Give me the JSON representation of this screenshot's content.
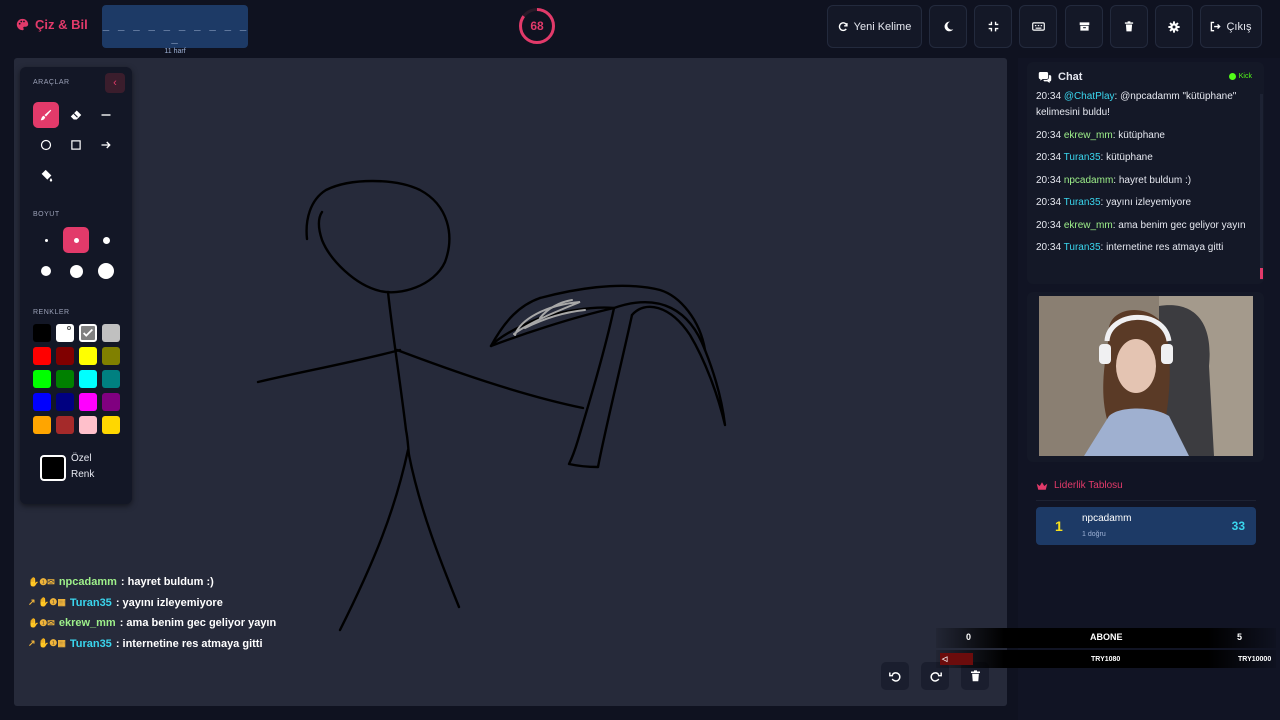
{
  "app": {
    "title": "Çiz & Bil"
  },
  "word": {
    "mask": "_ _ _ _ _ _ _ _ _ _ _",
    "hint": "11 harf"
  },
  "timer": {
    "value": "68",
    "fraction": 0.85
  },
  "toolbar": {
    "new_word": "Yeni Kelime",
    "exit": "Çıkış"
  },
  "tools_panel": {
    "tools_label": "ARAÇLAR",
    "size_label": "BOYUT",
    "colors_label": "RENKLER",
    "custom_line1": "Özel",
    "custom_line2": "Renk",
    "active_tool": "brush",
    "active_size": 2,
    "colors": [
      "#000000",
      "#ffffff",
      "#808080",
      "#c0c0c0",
      "#ff0000",
      "#800000",
      "#ffff00",
      "#808000",
      "#00ff00",
      "#008000",
      "#00ffff",
      "#008080",
      "#0000ff",
      "#000080",
      "#ff00ff",
      "#800080",
      "#ffa500",
      "#a52a2a",
      "#ffc0cb",
      "#ffd700"
    ],
    "selected_color": "#808080"
  },
  "overlay_chat": [
    {
      "user": "npcadamm",
      "text": ": hayret buldum :)",
      "color": "#9ef08a"
    },
    {
      "user": "Turan35",
      "text": ": yayını izleyemiyore",
      "color": "#3ad6ee"
    },
    {
      "user": "ekrew_mm",
      "text": ": ama benim gec geliyor yayın",
      "color": "#9ef08a"
    },
    {
      "user": "Turan35",
      "text": ": internetine res atmaya gitti",
      "color": "#3ad6ee"
    }
  ],
  "chat": {
    "title": "Chat",
    "platform": "Kick",
    "messages": [
      {
        "time": "20:34",
        "user": "@ChatPlay",
        "text": ": @npcadamm \"kütüphane\" kelimesini buldu!",
        "color": "#3ad6ee"
      },
      {
        "time": "20:34",
        "user": "ekrew_mm",
        "text": ": kütüphane",
        "color": "#9ef08a"
      },
      {
        "time": "20:34",
        "user": "Turan35",
        "text": ": kütüphane",
        "color": "#3ad6ee"
      },
      {
        "time": "20:34",
        "user": "npcadamm",
        "text": ": hayret buldum :)",
        "color": "#9ef08a"
      },
      {
        "time": "20:34",
        "user": "Turan35",
        "text": ": yayını izleyemiyore",
        "color": "#3ad6ee"
      },
      {
        "time": "20:34",
        "user": "ekrew_mm",
        "text": ": ama benim gec geliyor yayın",
        "color": "#9ef08a"
      },
      {
        "time": "20:34",
        "user": "Turan35",
        "text": ": internetine res atmaya gitti",
        "color": "#3ad6ee"
      }
    ]
  },
  "leaderboard": {
    "title": "Liderlik Tablosu",
    "entries": [
      {
        "rank": "1",
        "name": "npcadamm",
        "sub": "1 doğru",
        "score": "33"
      }
    ]
  },
  "goal": {
    "current": "0",
    "label": "ABONE",
    "target": "5",
    "left_tag": "TRY1080",
    "right_tag": "TRY10000",
    "progress": 0.1
  },
  "colors": {
    "accent": "#e23a6a",
    "panel": "#141827",
    "canvas": "#262a3a"
  }
}
